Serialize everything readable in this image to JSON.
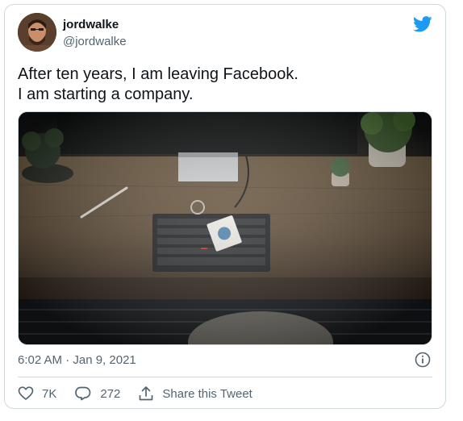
{
  "tweet": {
    "display_name": "jordwalke",
    "handle": "@jordwalke",
    "text_lines": [
      "After ten years, I am leaving Facebook.",
      "I am starting a company."
    ],
    "timestamp": "6:02 AM · Jan 9, 2021"
  },
  "actions": {
    "like_count": "7K",
    "reply_count": "272",
    "share_label": "Share this Tweet"
  },
  "icons": {
    "brand": "twitter-bird-icon",
    "info": "info-icon",
    "like": "heart-icon",
    "reply": "reply-icon",
    "share": "share-icon"
  },
  "colors": {
    "brand": "#1d9bf0",
    "text": "#0f1419",
    "secondary": "#536471",
    "border": "#cfd9de"
  }
}
